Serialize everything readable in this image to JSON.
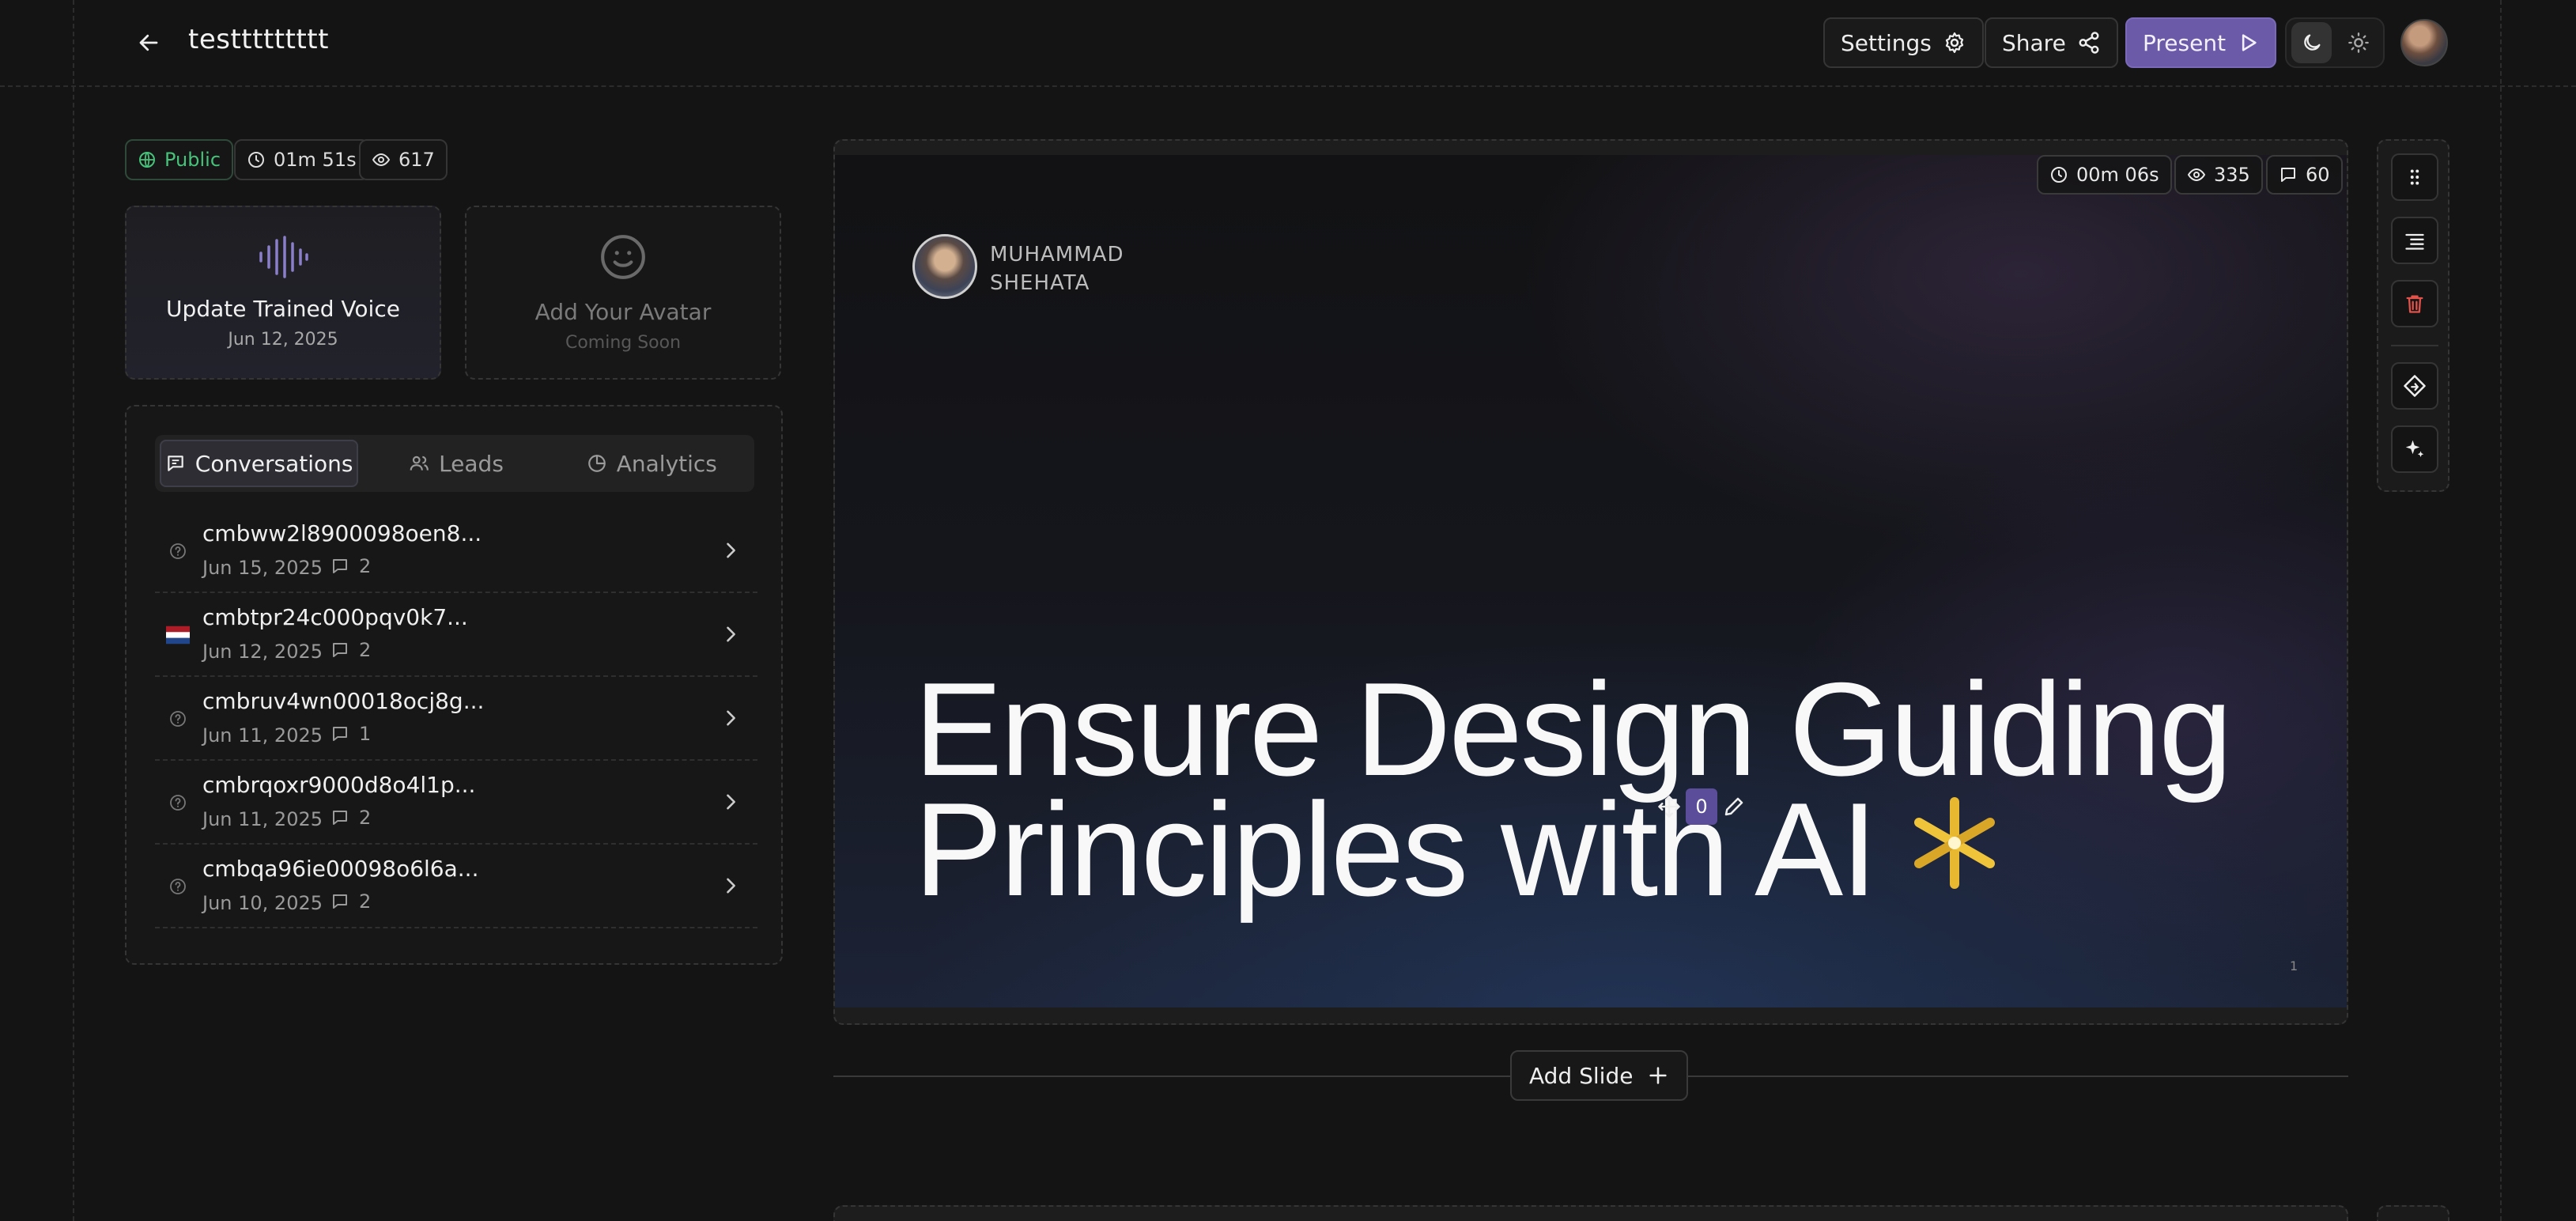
{
  "header": {
    "title": "testtttttttt",
    "settings_label": "Settings",
    "share_label": "Share",
    "present_label": "Present",
    "theme_options": [
      "moon-icon",
      "sun-icon"
    ]
  },
  "stats": {
    "visibility": "Public",
    "duration": "01m 51s",
    "views": "617"
  },
  "cards": {
    "voice": {
      "title": "Update Trained Voice",
      "subtitle": "Jun 12, 2025"
    },
    "avatar": {
      "title": "Add Your Avatar",
      "subtitle": "Coming Soon"
    }
  },
  "tabs": [
    {
      "label": "Conversations",
      "icon": "message-icon",
      "active": true
    },
    {
      "label": "Leads",
      "icon": "users-icon",
      "active": false
    },
    {
      "label": "Analytics",
      "icon": "pie-chart-icon",
      "active": false
    }
  ],
  "conversations": [
    {
      "id": "cmbww2l8900098oen8...",
      "date": "Jun 15, 2025",
      "count": "2",
      "icon": "unknown-region-icon"
    },
    {
      "id": "cmbtpr24c000pqv0k7...",
      "date": "Jun 12, 2025",
      "count": "2",
      "icon": "netherlands-flag-icon"
    },
    {
      "id": "cmbruv4wn00018ocj8g...",
      "date": "Jun 11, 2025",
      "count": "1",
      "icon": "unknown-region-icon"
    },
    {
      "id": "cmbrqoxr9000d8o4l1p...",
      "date": "Jun 11, 2025",
      "count": "2",
      "icon": "unknown-region-icon"
    },
    {
      "id": "cmbqa96ie00098o6l6a...",
      "date": "Jun 10, 2025",
      "count": "2",
      "icon": "unknown-region-icon"
    }
  ],
  "slide": {
    "duration": "00m 06s",
    "views": "335",
    "comments": "60",
    "presenter_line1": "MUHAMMAD",
    "presenter_line2": "SHEHATA",
    "headline_line1": "Ensure Design Guiding",
    "headline_line2": "Principles with AI",
    "edit_chip_value": "0",
    "slide_number": "1"
  },
  "toolbar": {
    "items": [
      "drag-handle-icon",
      "reorder-icon",
      "trash-icon",
      "diamond-icon",
      "sparkle-icon"
    ]
  },
  "add_slide_label": "Add Slide",
  "colors": {
    "accent": "#6b5aa8",
    "public_green": "#47c27a",
    "danger": "#e0524a",
    "background": "#141414"
  }
}
